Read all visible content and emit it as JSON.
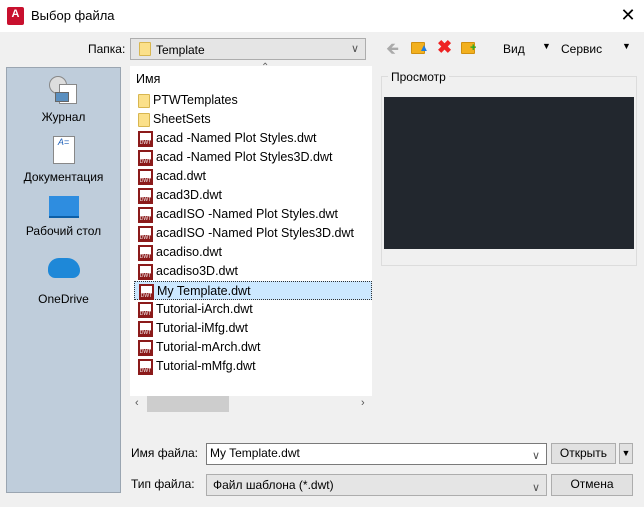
{
  "window": {
    "title": "Выбор файла",
    "app_icon": "A",
    "close": "✕"
  },
  "folder": {
    "label": "Папка:",
    "value": "Template"
  },
  "toolbar": {
    "back": "back-arrow-icon",
    "up": "folder-up-icon",
    "delete": "delete-icon",
    "new_folder": "new-folder-icon",
    "view_label": "Вид",
    "tools_label": "Сервис"
  },
  "sidebar": {
    "items": [
      {
        "label": "Журнал",
        "icon": "history-icon"
      },
      {
        "label": "Документация",
        "icon": "documents-icon"
      },
      {
        "label": "Рабочий стол",
        "icon": "desktop-icon"
      },
      {
        "label": "OneDrive",
        "icon": "onedrive-icon"
      }
    ]
  },
  "filelist": {
    "header": "Имя",
    "items": [
      {
        "name": "PTWTemplates",
        "type": "folder"
      },
      {
        "name": "SheetSets",
        "type": "folder"
      },
      {
        "name": "acad -Named Plot Styles.dwt",
        "type": "dwt"
      },
      {
        "name": "acad -Named Plot Styles3D.dwt",
        "type": "dwt"
      },
      {
        "name": "acad.dwt",
        "type": "dwt"
      },
      {
        "name": "acad3D.dwt",
        "type": "dwt"
      },
      {
        "name": "acadISO -Named Plot Styles.dwt",
        "type": "dwt"
      },
      {
        "name": "acadISO -Named Plot Styles3D.dwt",
        "type": "dwt"
      },
      {
        "name": "acadiso.dwt",
        "type": "dwt"
      },
      {
        "name": "acadiso3D.dwt",
        "type": "dwt"
      },
      {
        "name": "My Template.dwt",
        "type": "dwt",
        "selected": true
      },
      {
        "name": "Tutorial-iArch.dwt",
        "type": "dwt"
      },
      {
        "name": "Tutorial-iMfg.dwt",
        "type": "dwt"
      },
      {
        "name": "Tutorial-mArch.dwt",
        "type": "dwt"
      },
      {
        "name": "Tutorial-mMfg.dwt",
        "type": "dwt"
      }
    ]
  },
  "preview": {
    "label": "Просмотр",
    "bg": "#22272e"
  },
  "filename": {
    "label": "Имя файла:",
    "value": "My Template.dwt"
  },
  "filetype": {
    "label": "Тип файла:",
    "value": "Файл шаблона (*.dwt)"
  },
  "buttons": {
    "open": "Открыть",
    "cancel": "Отмена"
  }
}
